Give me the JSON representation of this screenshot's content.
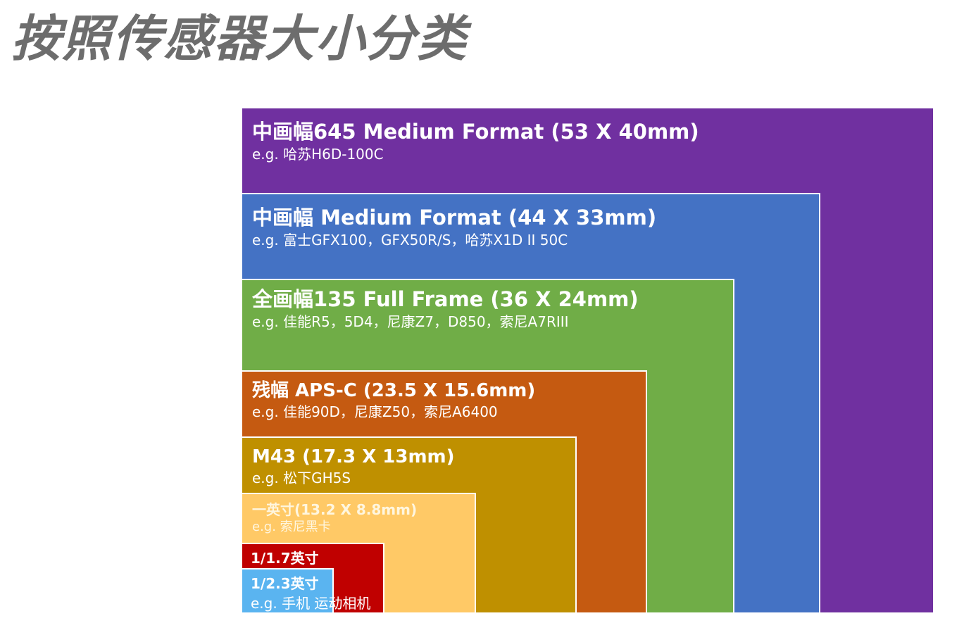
{
  "title": "按照传感器大小分类",
  "sensors": {
    "mf645": {
      "label": "中画幅645 Medium Format (53 X 40mm)",
      "example": "e.g. 哈苏H6D-100C",
      "color": "#7030a0"
    },
    "mf": {
      "label": "中画幅 Medium Format (44 X 33mm)",
      "example": "e.g. 富士GFX100，GFX50R/S，哈苏X1D II 50C",
      "color": "#4472c4"
    },
    "ff": {
      "label": "全画幅135 Full Frame (36 X 24mm)",
      "example": "e.g. 佳能R5，5D4，尼康Z7，D850，索尼A7RIII",
      "color": "#70ad47"
    },
    "apsc": {
      "label": "残幅 APS-C (23.5 X 15.6mm)",
      "example": "e.g. 佳能90D，尼康Z50，索尼A6400",
      "color": "#c55a11"
    },
    "m43": {
      "label": "M43 (17.3 X 13mm)",
      "example": "e.g. 松下GH5S",
      "color": "#bf9000"
    },
    "one_inch": {
      "label": "一英寸(13.2 X 8.8mm)",
      "example": "e.g. 索尼黑卡",
      "color": "#ffc966"
    },
    "inch_1_7": {
      "label": "1/1.7英寸",
      "color": "#c00000"
    },
    "inch_2_3": {
      "label": "1/2.3英寸",
      "example": "e.g. 手机 运动相机",
      "color": "#5ab4f0"
    }
  }
}
